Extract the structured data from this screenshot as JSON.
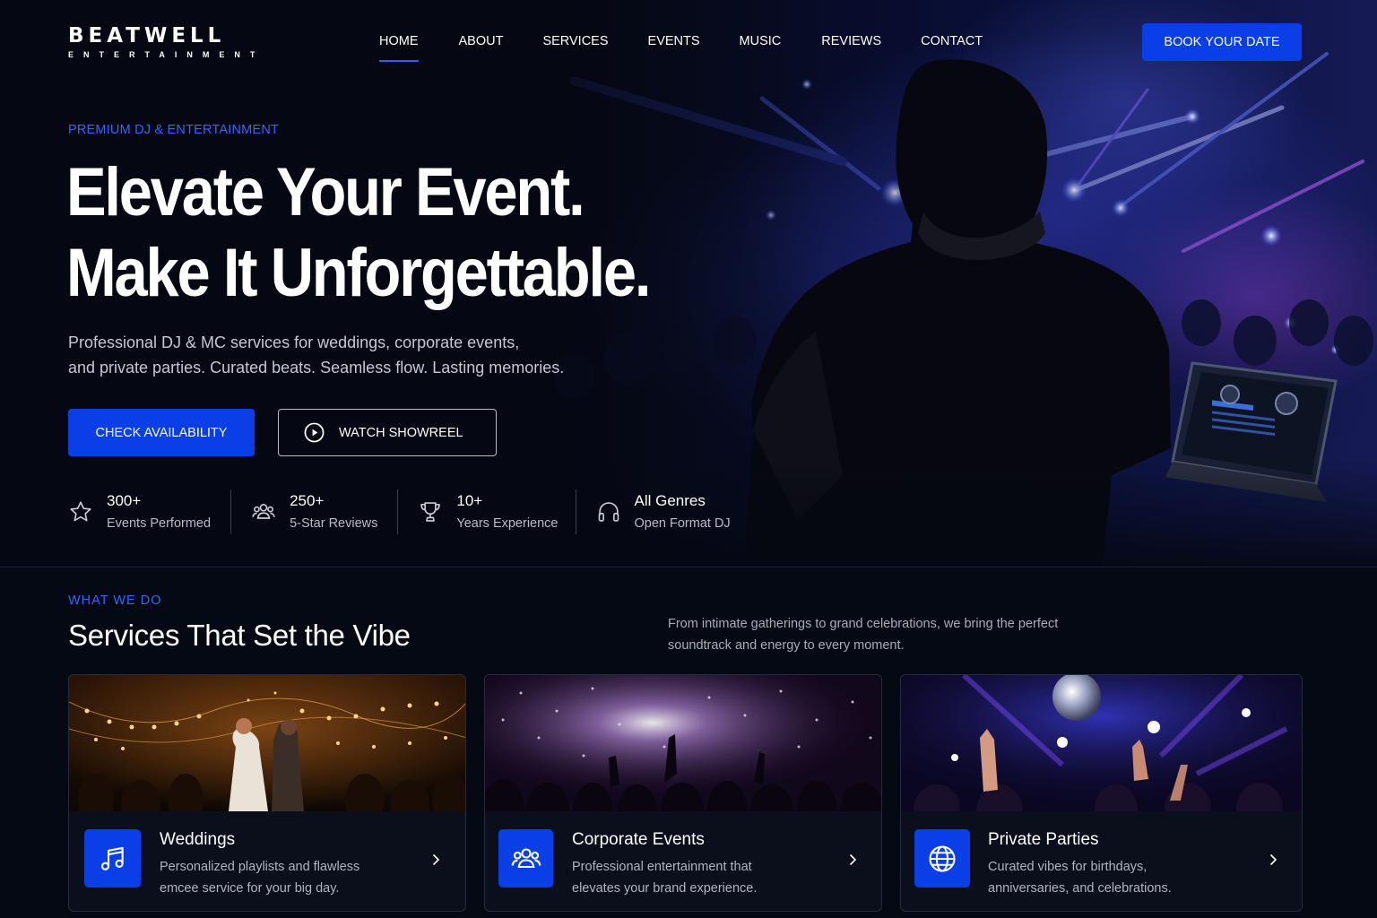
{
  "brand": {
    "name": "BEATWELL",
    "tagline": "ENTERTAINMENT"
  },
  "nav": {
    "items": [
      {
        "label": "HOME",
        "active": true
      },
      {
        "label": "ABOUT"
      },
      {
        "label": "SERVICES"
      },
      {
        "label": "EVENTS"
      },
      {
        "label": "MUSIC"
      },
      {
        "label": "REVIEWS"
      },
      {
        "label": "CONTACT"
      }
    ],
    "cta": "BOOK YOUR DATE"
  },
  "hero": {
    "eyebrow": "PREMIUM DJ & ENTERTAINMENT",
    "headline_line1": "Elevate Your Event.",
    "headline_line2": "Make It Unforgettable.",
    "sub_line1": "Professional DJ & MC services for weddings, corporate events,",
    "sub_line2": "and private parties. Curated beats. Seamless flow. Lasting memories.",
    "primary_button": "CHECK AVAILABILITY",
    "secondary_button": "WATCH SHOWREEL"
  },
  "stats": [
    {
      "value": "300+",
      "label": "Events Performed",
      "icon": "star-icon"
    },
    {
      "value": "250+",
      "label": "5-Star Reviews",
      "icon": "users-icon"
    },
    {
      "value": "10+",
      "label": "Years Experience",
      "icon": "trophy-icon"
    },
    {
      "value": "All Genres",
      "label": "Open Format DJ",
      "icon": "headphones-icon"
    }
  ],
  "services": {
    "eyebrow": "WHAT WE DO",
    "title": "Services That Set the Vibe",
    "desc_line1": "From intimate gatherings to grand celebrations, we bring the perfect",
    "desc_line2": "soundtrack and energy to every moment.",
    "cards": [
      {
        "title": "Weddings",
        "line1": "Personalized playlists and flawless",
        "line2": "emcee service for your big day.",
        "icon": "music-note-icon"
      },
      {
        "title": "Corporate Events",
        "line1": "Professional entertainment that",
        "line2": "elevates your brand experience.",
        "icon": "users-icon"
      },
      {
        "title": "Private Parties",
        "line1": "Curated vibes for birthdays,",
        "line2": "anniversaries, and celebrations.",
        "icon": "globe-icon"
      }
    ]
  },
  "colors": {
    "accent": "#0a3fe8",
    "eyebrow": "#3566ff",
    "background": "#050914"
  }
}
